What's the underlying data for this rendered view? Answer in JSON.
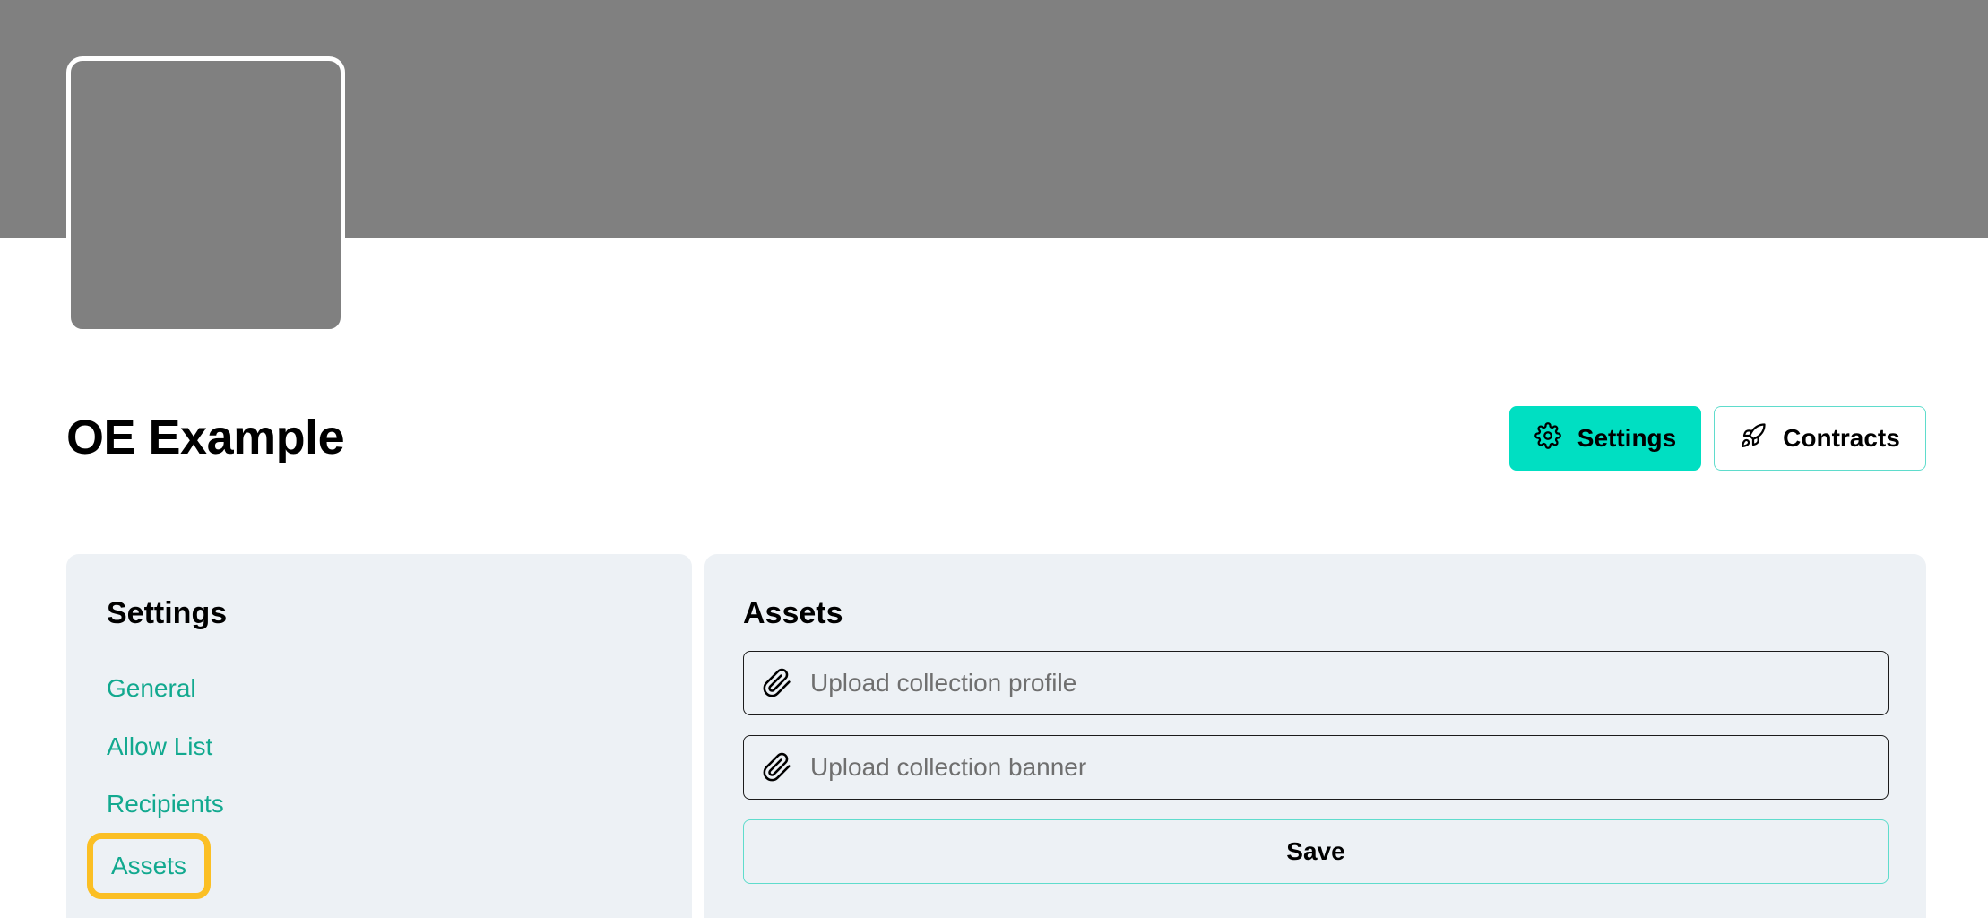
{
  "collection": {
    "title": "OE Example"
  },
  "header_actions": {
    "settings_label": "Settings",
    "contracts_label": "Contracts",
    "settings_icon": "gear-icon",
    "contracts_icon": "rocket-icon"
  },
  "settings_nav": {
    "heading": "Settings",
    "items": [
      {
        "label": "General"
      },
      {
        "label": "Allow List"
      },
      {
        "label": "Recipients"
      },
      {
        "label": "Assets",
        "active": true
      }
    ]
  },
  "assets_panel": {
    "heading": "Assets",
    "profile_upload_placeholder": "Upload collection profile",
    "banner_upload_placeholder": "Upload collection banner",
    "upload_icon": "paperclip-icon",
    "save_label": "Save"
  },
  "colors": {
    "accent": "#00dfc2",
    "link": "#12a98f",
    "highlight": "#fbbf24",
    "panel_bg": "#edf1f5",
    "banner_bg": "#808080"
  }
}
